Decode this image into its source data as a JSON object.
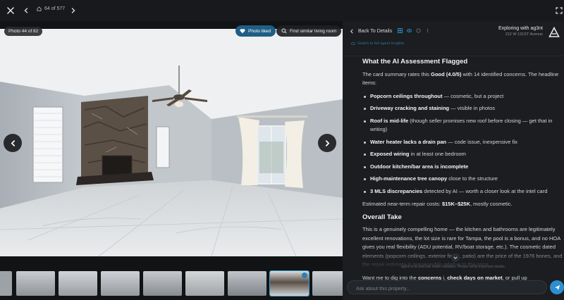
{
  "topbar": {
    "counter": "64 of 577"
  },
  "viewer": {
    "photo_badge": "Photo 44 of 82",
    "liked_label": "Photo liked",
    "similar_label": "Find similar living room"
  },
  "panel": {
    "back_label": "Back To Details",
    "explore_title": "Exploring with ag3nt",
    "explore_address": "212 W 131ST Avenue",
    "sub_link": "Switch to full agent insights",
    "section1_title": "What the AI Assessment Flagged",
    "intro_pre": "The card summary rates this ",
    "intro_bold": "Good (4.0/5)",
    "intro_post": " with 14 identified concerns. The headline items:",
    "flags": [
      {
        "bold": "Popcorn ceilings throughout",
        "text": " — cosmetic, but a project"
      },
      {
        "bold": "Driveway cracking and staining",
        "text": " — visible in photos"
      },
      {
        "bold": "Roof is mid-life",
        "text": " (though seller promises new roof before closing — get that in writing)"
      },
      {
        "bold": "Water heater lacks a drain pan",
        "text": " — code issue, inexpensive fix"
      },
      {
        "bold": "Exposed wiring",
        "text": " in at least one bedroom"
      },
      {
        "bold": "Outdoor kitchen/bar area is incomplete",
        "text": ""
      },
      {
        "bold": "High-maintenance tree canopy",
        "text": " close to the structure"
      },
      {
        "bold": "3 MLS discrepancies",
        "text": " detected by AI — worth a closer look at the intel card"
      }
    ],
    "repair_pre": "Estimated near-term repair costs: ",
    "repair_bold": "$15K–$25K",
    "repair_post": ", mostly cosmetic.",
    "section2_title": "Overall Take",
    "take_text": "This is a genuinely compelling home — the kitchen and bathrooms are legitimately excellent renovations, the lot size is rare for Tampa, the pool is a bonus, and no HOA gives you real flexibility (ADU potential, RV/boat storage, etc.). The cosmetic dated elements (popcorn ceilings, exterior finish, patio) are the price of the 1976 bones, and the repair estimate is manageable relative to the price.",
    "followup_pre": "Want me to dig into the ",
    "followup_bold1": "concerns",
    "followup_mid": " i, ",
    "followup_bold2": "check days on market",
    "followup_post": ", or pull up",
    "disclaimer": "ag3nt is AI and can make mistakes. Please verify important details.",
    "input_placeholder": "Ask about this property..."
  },
  "colors": {
    "accent": "#2d8fcf",
    "liked_bg": "#1f5f85",
    "panel_bg": "#1b1d20"
  }
}
